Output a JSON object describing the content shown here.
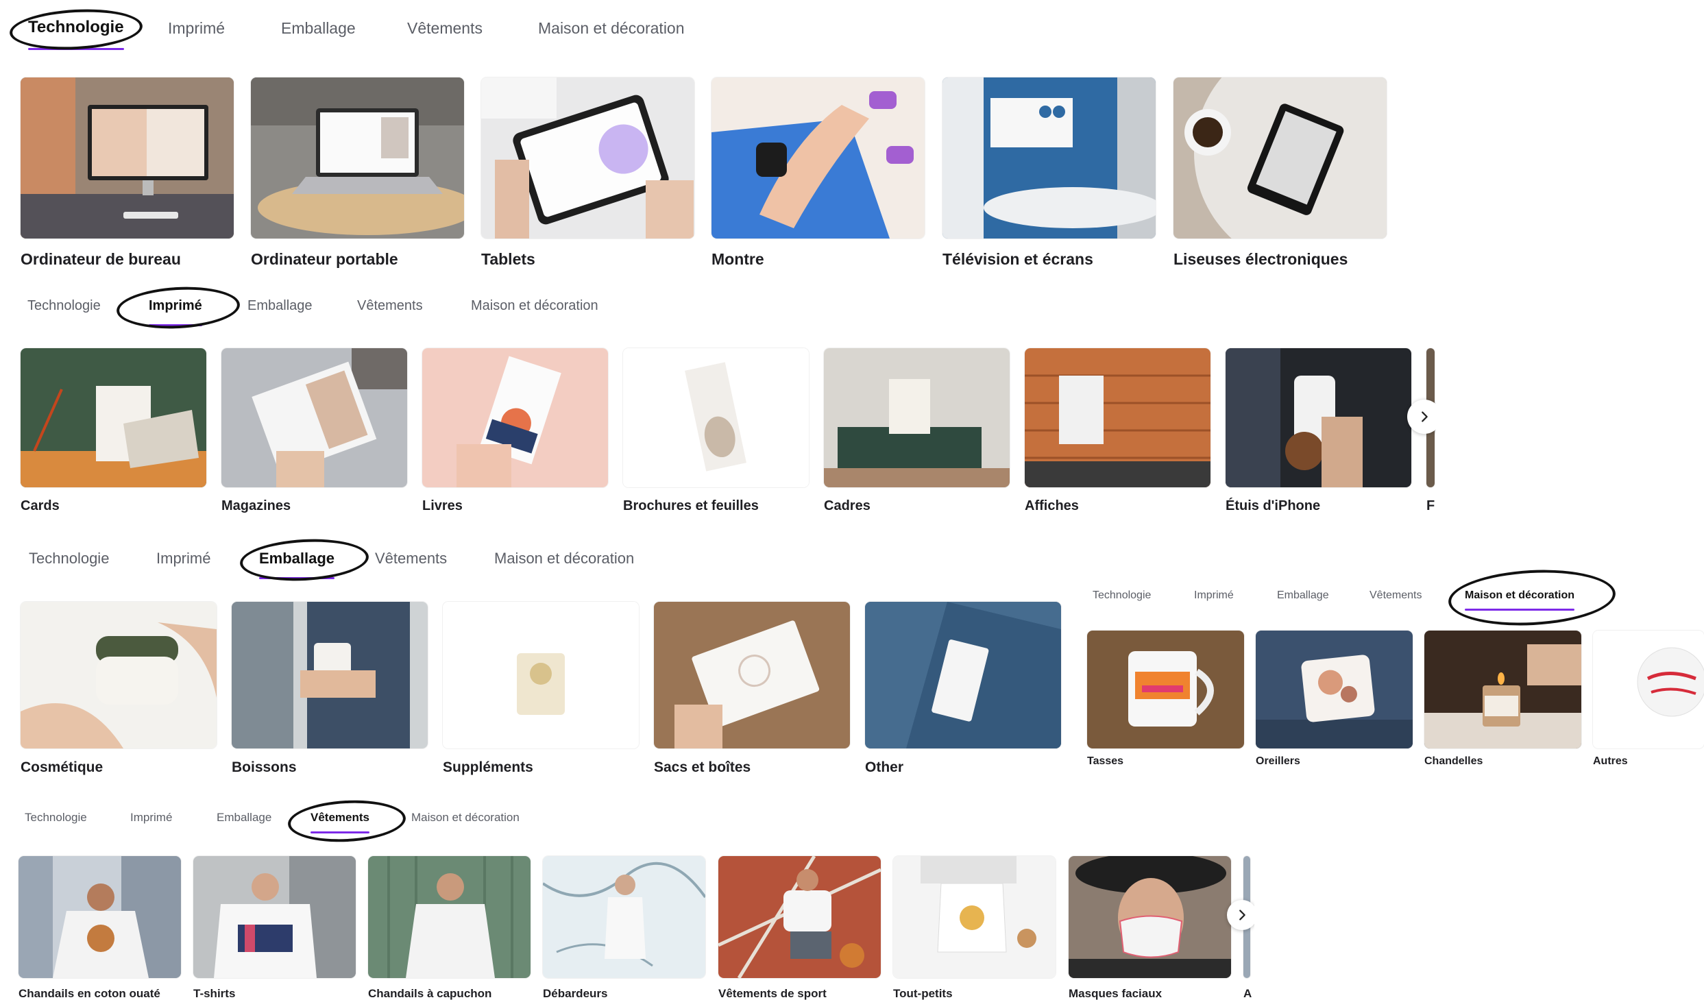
{
  "tabs": [
    "Technologie",
    "Imprimé",
    "Emballage",
    "Vêtements",
    "Maison et décoration"
  ],
  "technology": {
    "active": "Technologie",
    "items": [
      "Ordinateur de bureau",
      "Ordinateur portable",
      "Tablets",
      "Montre",
      "Télévision et écrans",
      "Liseuses électroniques"
    ]
  },
  "print": {
    "active": "Imprimé",
    "items": [
      "Cards",
      "Magazines",
      "Livres",
      "Brochures et feuilles",
      "Cadres",
      "Affiches",
      "Étuis d'iPhone",
      "F"
    ]
  },
  "packaging": {
    "active": "Emballage",
    "items": [
      "Cosmétique",
      "Boissons",
      "Suppléments",
      "Sacs et boîtes",
      "Other"
    ]
  },
  "home": {
    "active": "Maison et décoration",
    "items": [
      "Tasses",
      "Oreillers",
      "Chandelles",
      "Autres"
    ]
  },
  "clothing": {
    "active": "Vêtements",
    "items": [
      "Chandails en coton ouaté",
      "T-shirts",
      "Chandails à capuchon",
      "Débardeurs",
      "Vêtements de sport",
      "Tout-petits",
      "Masques faciaux",
      "A"
    ]
  },
  "icons": {
    "next": "chevron-right-icon"
  },
  "colors": {
    "accent": "#7d2ae8"
  }
}
